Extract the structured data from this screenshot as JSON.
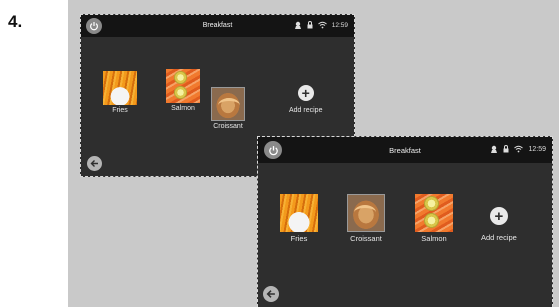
{
  "step": {
    "number": "4."
  },
  "screen_before": {
    "title": "Breakfast",
    "time": "12:59",
    "recipes": [
      {
        "label": "Fries",
        "image": "fries-thumbnail"
      },
      {
        "label": "Salmon",
        "image": "salmon-thumbnail"
      },
      {
        "label": "Croissant",
        "image": "croissant-thumbnail"
      }
    ],
    "add_label": "Add recipe",
    "icons": [
      "power-icon",
      "chef-icon",
      "lock-icon",
      "wifi-icon",
      "back-arrow-icon",
      "plus-icon"
    ]
  },
  "screen_after": {
    "title": "Breakfast",
    "time": "12:59",
    "recipes": [
      {
        "label": "Fries",
        "image": "fries-thumbnail"
      },
      {
        "label": "Croissant",
        "image": "croissant-thumbnail"
      },
      {
        "label": "Salmon",
        "image": "salmon-thumbnail"
      }
    ],
    "add_label": "Add recipe",
    "icons": [
      "power-icon",
      "chef-icon",
      "lock-icon",
      "wifi-icon",
      "back-arrow-icon",
      "plus-icon"
    ]
  },
  "colors": {
    "screen_bg": "#2e2e2e",
    "status_bar_bg": "#141414",
    "backdrop": "#c9c9c9"
  }
}
